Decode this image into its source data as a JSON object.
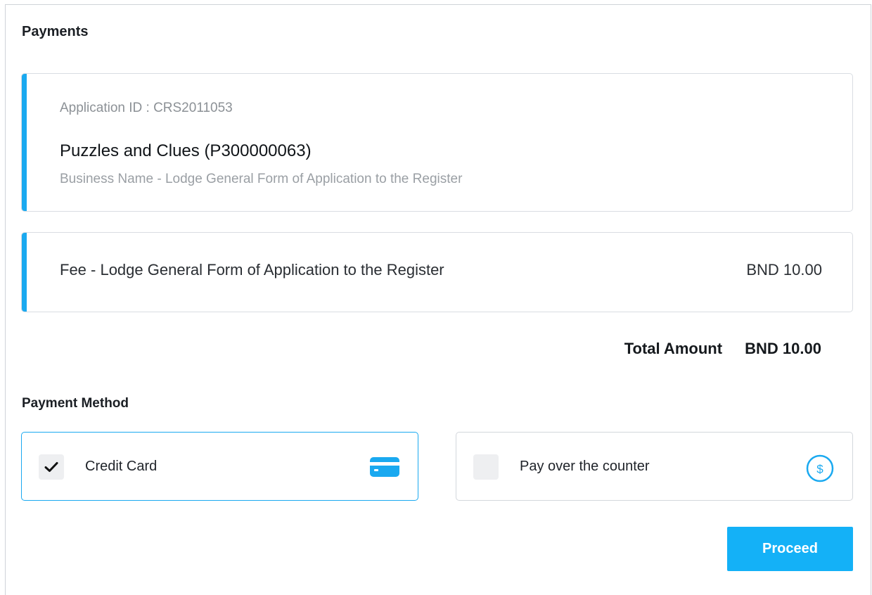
{
  "header": {
    "title": "Payments"
  },
  "application": {
    "id_text": "Application ID : CRS2011053",
    "name": "Puzzles and Clues (P300000063)",
    "description": "Business Name - Lodge General Form of Application to the Register"
  },
  "fee": {
    "label": "Fee - Lodge General Form of Application to the Register",
    "amount": "BND 10.00"
  },
  "total": {
    "label": "Total Amount",
    "amount": "BND 10.00"
  },
  "payment_method": {
    "title": "Payment Method",
    "options": [
      {
        "label": "Credit Card",
        "checked": true,
        "icon": "credit-card-icon"
      },
      {
        "label": "Pay over the counter",
        "checked": false,
        "icon": "dollar-circle-icon"
      }
    ]
  },
  "actions": {
    "proceed_label": "Proceed"
  },
  "colors": {
    "accent": "#1aa9f0",
    "button": "#14b1f7"
  }
}
